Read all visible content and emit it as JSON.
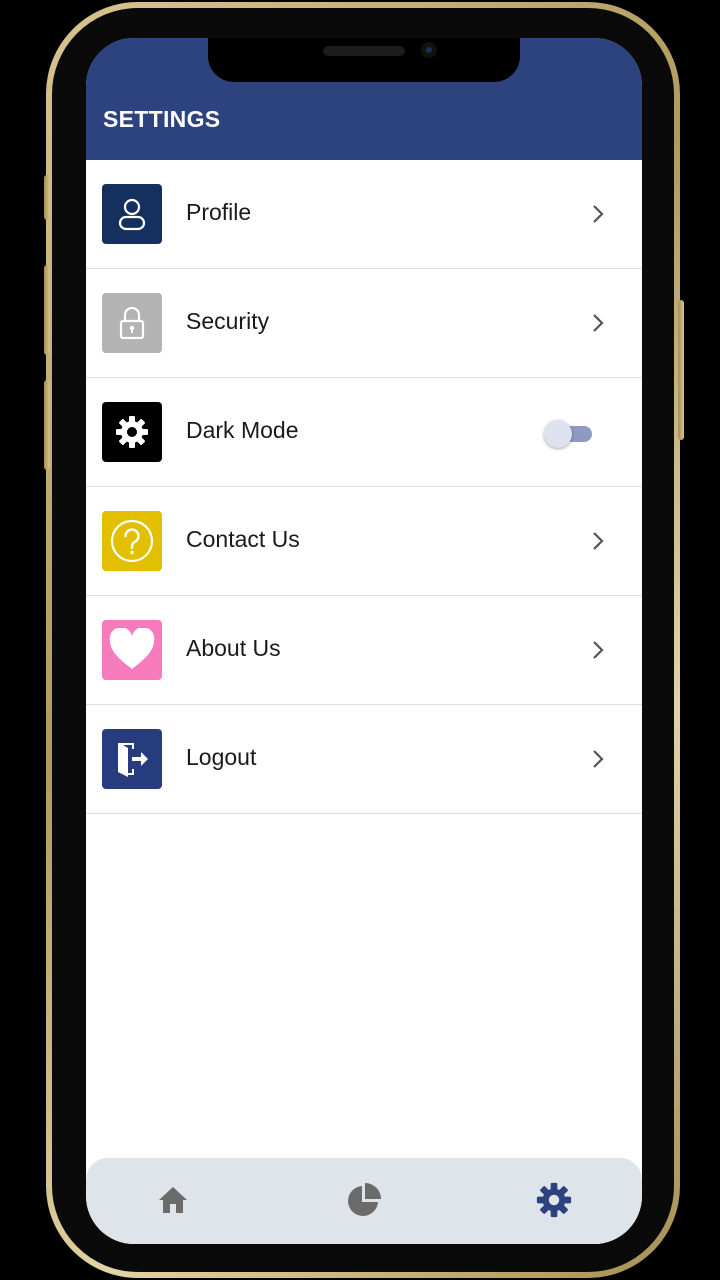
{
  "header": {
    "title": "SETTINGS"
  },
  "settings": {
    "items": [
      {
        "label": "Profile",
        "icon": "user-icon",
        "icon_bg": "#15305f",
        "trailing": "chevron"
      },
      {
        "label": "Security",
        "icon": "lock-icon",
        "icon_bg": "#b3b3b3",
        "trailing": "chevron"
      },
      {
        "label": "Dark Mode",
        "icon": "gear-icon",
        "icon_bg": "#000000",
        "trailing": "toggle",
        "toggle_on": false
      },
      {
        "label": "Contact Us",
        "icon": "question-icon",
        "icon_bg": "#e2c000",
        "trailing": "chevron"
      },
      {
        "label": "About Us",
        "icon": "heart-icon",
        "icon_bg": "#f57bbd",
        "trailing": "chevron"
      },
      {
        "label": "Logout",
        "icon": "logout-icon",
        "icon_bg": "#263c7d",
        "trailing": "chevron"
      }
    ]
  },
  "tabbar": {
    "tabs": [
      {
        "icon": "home-icon",
        "active": false
      },
      {
        "icon": "pie-chart-icon",
        "active": false
      },
      {
        "icon": "gear-icon",
        "active": true
      }
    ],
    "active_color": "#2c437f",
    "inactive_color": "#6b6b6b"
  },
  "colors": {
    "header_bg": "#2c437f",
    "screen_bg": "#ffffff"
  }
}
